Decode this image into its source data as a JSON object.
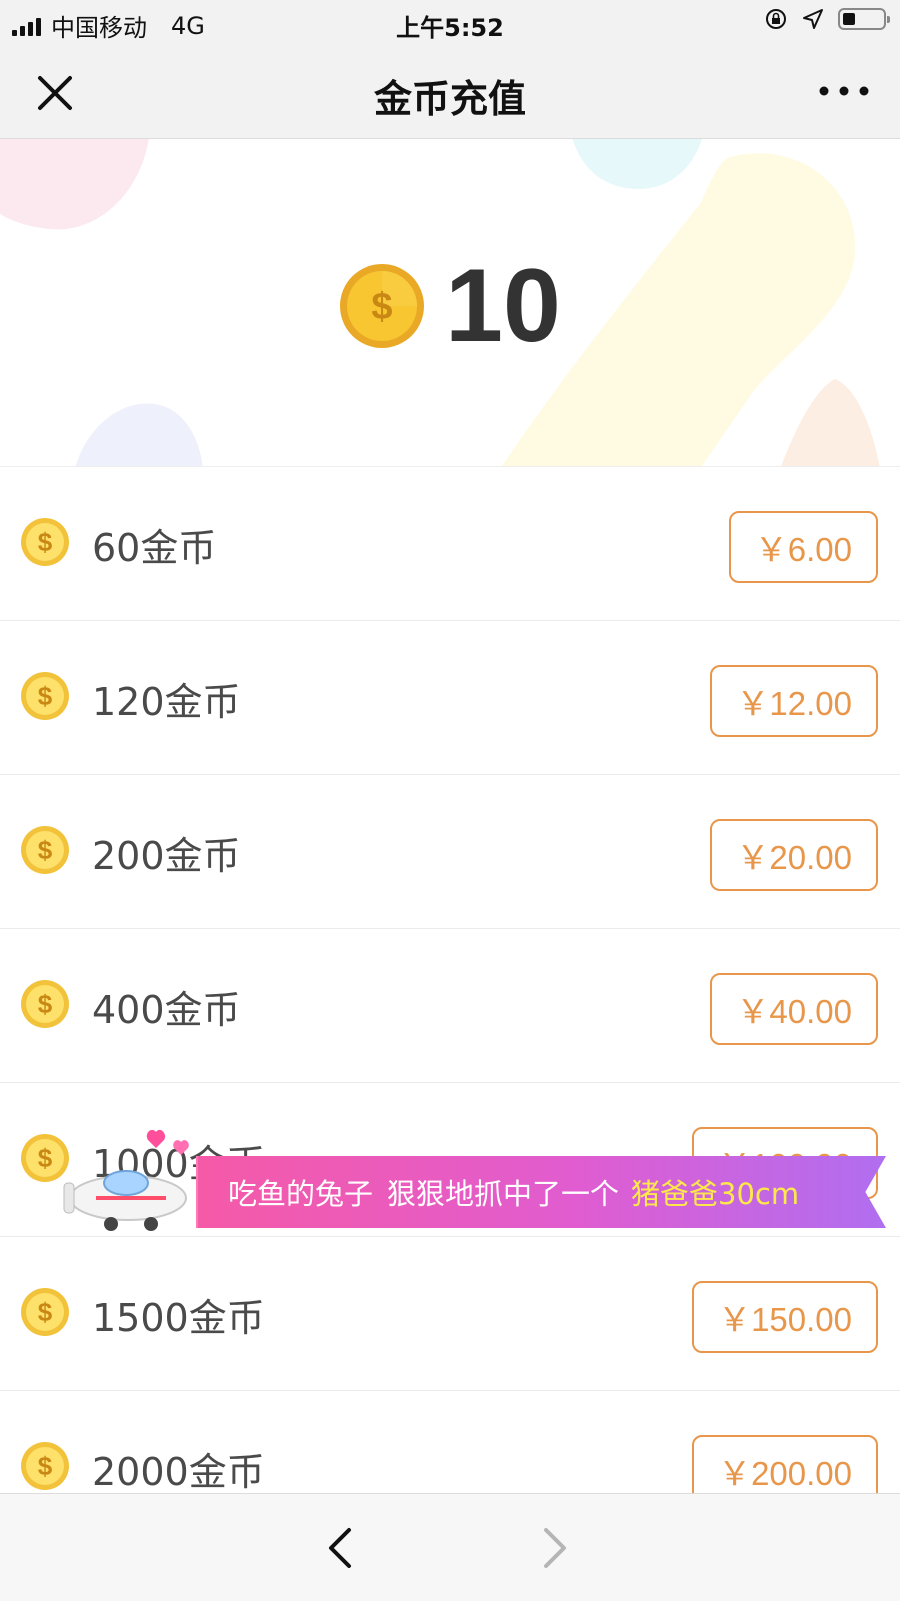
{
  "status_bar": {
    "carrier": "中国移动",
    "network": "4G",
    "time": "上午5:52",
    "battery_level": 0.3
  },
  "nav": {
    "title": "金币充值",
    "close_icon": "close-icon",
    "more_icon": "more-icon"
  },
  "balance": {
    "value": "10",
    "icon": "gold-coin-icon"
  },
  "packages": [
    {
      "label": "60金币",
      "price": "￥6.00"
    },
    {
      "label": "120金币",
      "price": "￥12.00"
    },
    {
      "label": "200金币",
      "price": "￥20.00"
    },
    {
      "label": "400金币",
      "price": "￥40.00"
    },
    {
      "label": "1000金币",
      "price": "￥100.00"
    },
    {
      "label": "1500金币",
      "price": "￥150.00"
    },
    {
      "label": "2000金币",
      "price": "￥200.00"
    }
  ],
  "notice": {
    "user": "吃鱼的兔子",
    "message": "狠狠地抓中了一个",
    "prize": "猪爸爸30cm"
  },
  "colors": {
    "price_accent": "#e8964a",
    "coin_gold": "#f5c518",
    "notice_highlight": "#ffe94a"
  }
}
